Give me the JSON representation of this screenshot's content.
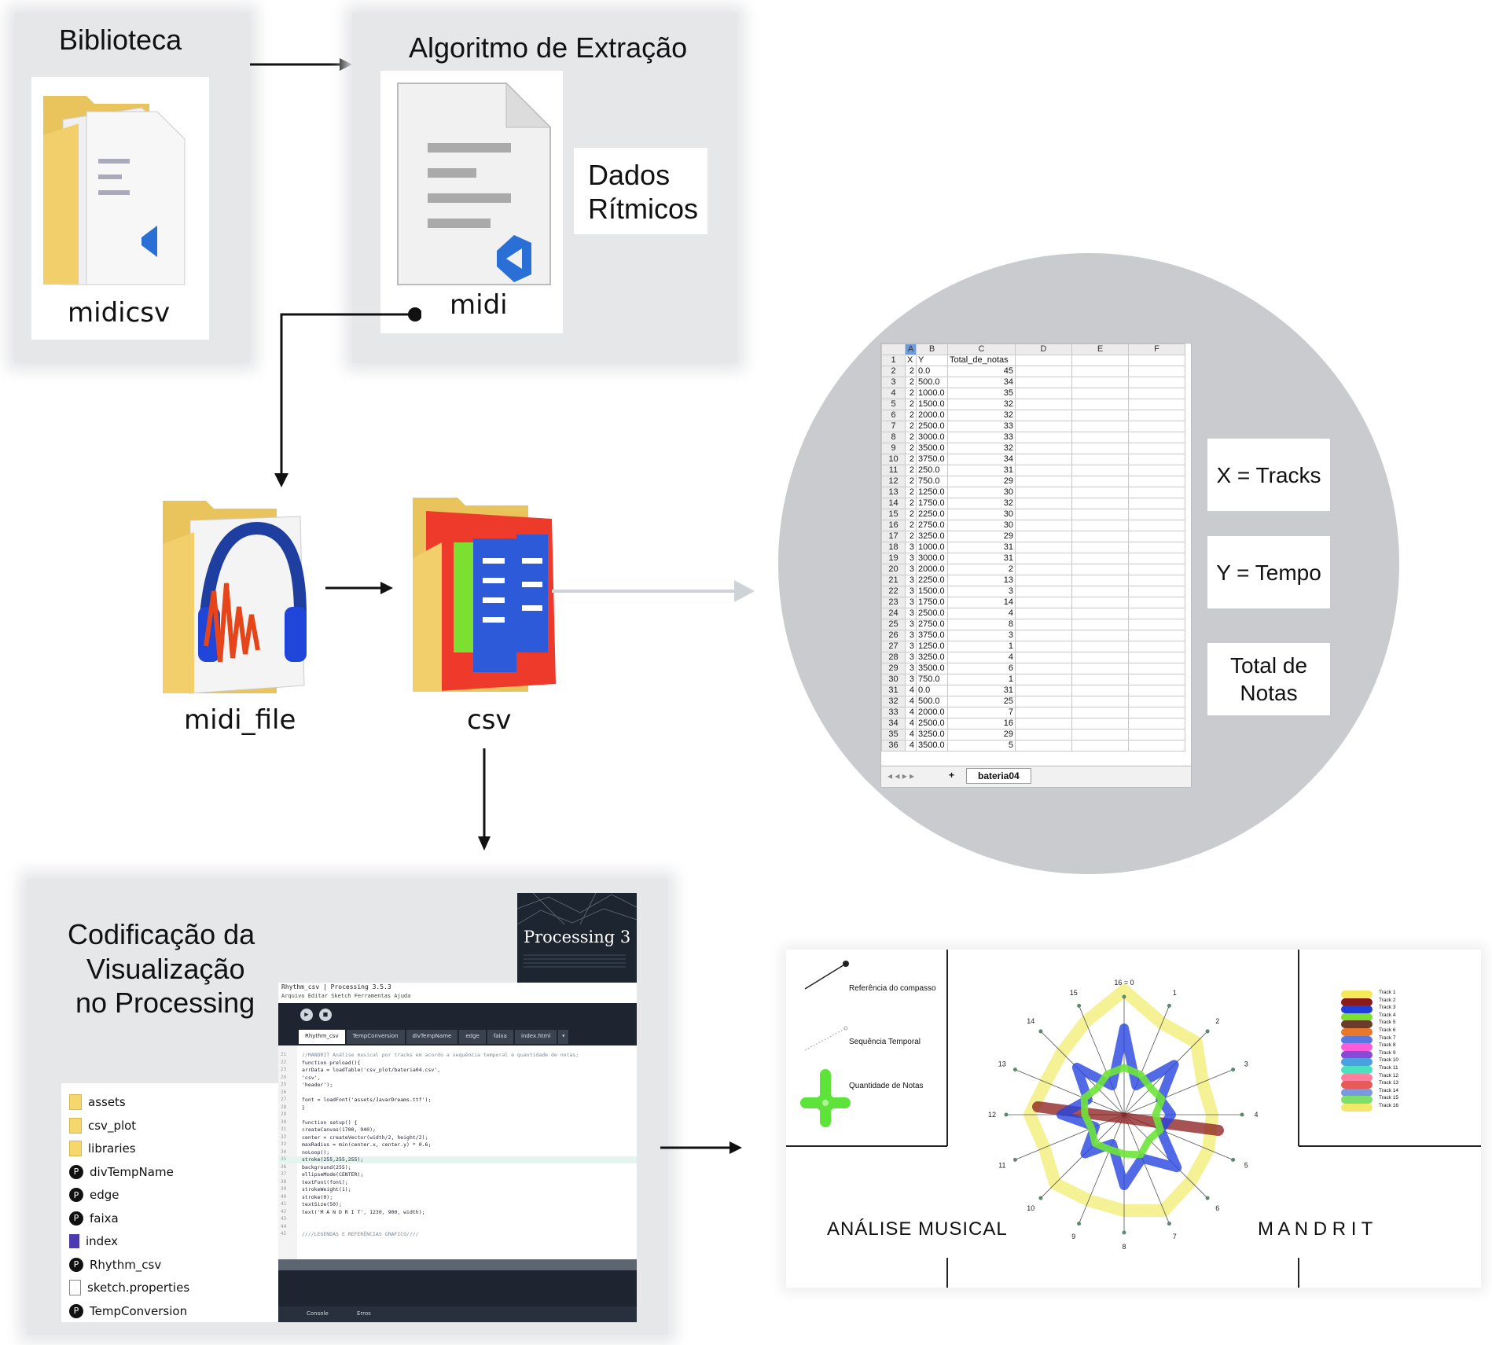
{
  "labels": {
    "biblioteca": "Biblioteca",
    "algoritmo": "Algoritmo de Extração",
    "dados_line1": "Dados",
    "dados_line2": "Rítmicos",
    "midicsv": "midicsv",
    "midi": "midi",
    "midi_file": "midi_file",
    "csv": "csv",
    "codificacao_line1": "Codificação da",
    "codificacao_line2": "Visualização",
    "codificacao_line3": "no Processing"
  },
  "legend_boxes": {
    "x": "X = Tracks",
    "y": "Y = Tempo",
    "z_line1": "Total de",
    "z_line2": "Notas"
  },
  "spreadsheet": {
    "columns": [
      "A",
      "B",
      "C",
      "D",
      "E",
      "F"
    ],
    "header": [
      "X",
      "Y",
      "Total_de_notas"
    ],
    "rows": [
      [
        "2",
        "0.0",
        "45"
      ],
      [
        "2",
        "500.0",
        "34"
      ],
      [
        "2",
        "1000.0",
        "35"
      ],
      [
        "2",
        "1500.0",
        "32"
      ],
      [
        "2",
        "2000.0",
        "32"
      ],
      [
        "2",
        "2500.0",
        "33"
      ],
      [
        "2",
        "3000.0",
        "33"
      ],
      [
        "2",
        "3500.0",
        "32"
      ],
      [
        "2",
        "3750.0",
        "34"
      ],
      [
        "2",
        "250.0",
        "31"
      ],
      [
        "2",
        "750.0",
        "29"
      ],
      [
        "2",
        "1250.0",
        "30"
      ],
      [
        "2",
        "1750.0",
        "32"
      ],
      [
        "2",
        "2250.0",
        "30"
      ],
      [
        "2",
        "2750.0",
        "30"
      ],
      [
        "2",
        "3250.0",
        "29"
      ],
      [
        "3",
        "1000.0",
        "31"
      ],
      [
        "3",
        "3000.0",
        "31"
      ],
      [
        "3",
        "2000.0",
        "2"
      ],
      [
        "3",
        "2250.0",
        "13"
      ],
      [
        "3",
        "1500.0",
        "3"
      ],
      [
        "3",
        "1750.0",
        "14"
      ],
      [
        "3",
        "2500.0",
        "4"
      ],
      [
        "3",
        "2750.0",
        "8"
      ],
      [
        "3",
        "3750.0",
        "3"
      ],
      [
        "3",
        "1250.0",
        "1"
      ],
      [
        "3",
        "3250.0",
        "4"
      ],
      [
        "3",
        "3500.0",
        "6"
      ],
      [
        "3",
        "750.0",
        "1"
      ],
      [
        "4",
        "0.0",
        "31"
      ],
      [
        "4",
        "500.0",
        "25"
      ],
      [
        "4",
        "2000.0",
        "7"
      ],
      [
        "4",
        "2500.0",
        "16"
      ],
      [
        "4",
        "3250.0",
        "29"
      ],
      [
        "4",
        "3500.0",
        "5"
      ]
    ],
    "sheet_tab": "bateria04",
    "add_tab": "+"
  },
  "processing": {
    "splash_title": "Processing 3",
    "window_title": "Rhythm_csv | Processing 3.5.3",
    "menu": "Arquivo  Editar  Sketch  Ferramentas  Ajuda",
    "tabs": [
      "Rhythm_csv",
      "TempConversion",
      "divTempName",
      "edge",
      "faixa",
      "index.html"
    ],
    "code_lines": [
      "//MANDRIT  Análise musical por tracks em acordo a sequência temporal e quantidade de notas;",
      "function preload(){",
      "  arrData = loadTable('csv_plot/bateria04.csv',",
      "    'csv',",
      "    'header');",
      "",
      "  font = loadFont('assets/JavarDreams.ttf');",
      "}",
      "",
      "function setup() {",
      "  createCanvas(1700, 940);",
      "  center = createVector(width/2, height/2);",
      "  maxRadius = min(center.x, center.y) * 0.6;",
      "  noLoop();",
      "  stroke(255,255,255);",
      "  background(255);",
      "  ellipseMode(CENTER);",
      "  textFont(font);",
      "    strokeWeight(1);",
      "    stroke(0);",
      "    textSize(50);",
      "    text('M A N D R I T', 1230, 900, width);",
      "",
      "",
      "////LEGENDAS E REFERÊNCIAS GRAFICO////"
    ],
    "footer": [
      "Console",
      "Erros"
    ]
  },
  "files": {
    "items": [
      {
        "name": "assets",
        "type": "folder"
      },
      {
        "name": "csv_plot",
        "type": "folder"
      },
      {
        "name": "libraries",
        "type": "folder"
      },
      {
        "name": "divTempName",
        "type": "pde"
      },
      {
        "name": "edge",
        "type": "pde"
      },
      {
        "name": "faixa",
        "type": "pde"
      },
      {
        "name": "index",
        "type": "html"
      },
      {
        "name": "Rhythm_csv",
        "type": "pde"
      },
      {
        "name": "sketch.properties",
        "type": "file"
      },
      {
        "name": "TempConversion",
        "type": "pde"
      }
    ]
  },
  "viz": {
    "ref_compasso": "Referência do compasso",
    "seq_temporal": "Sequência Temporal",
    "qtd_notas": "Quantidade de Notas",
    "left_title": "ANÁLISE MUSICAL",
    "right_title": "M A N D R I T",
    "spoke_labels": [
      "16 = 0",
      "1",
      "2",
      "3",
      "4",
      "5",
      "6",
      "7",
      "8",
      "9",
      "10",
      "11",
      "12",
      "13",
      "14",
      "15"
    ],
    "track_legend": [
      "Track 1",
      "Track 2",
      "Track 3",
      "Track 4",
      "Track 5",
      "Track 6",
      "Track 7",
      "Track 8",
      "Track 9",
      "Track 10",
      "Track 11",
      "Track 12",
      "Track 13",
      "Track 14",
      "Track 15",
      "Track 16"
    ],
    "track_colors": [
      "#f5e85a",
      "#8b1a1a",
      "#1f3fd8",
      "#7de030",
      "#6b3b2b",
      "#e8782a",
      "#5a78e0",
      "#ff5ad9",
      "#8a4ad8",
      "#4aa0e0",
      "#4ae0c0",
      "#ff7f9e",
      "#e85a5a",
      "#7a9ae0",
      "#7de06a",
      "#f2e86a"
    ]
  }
}
